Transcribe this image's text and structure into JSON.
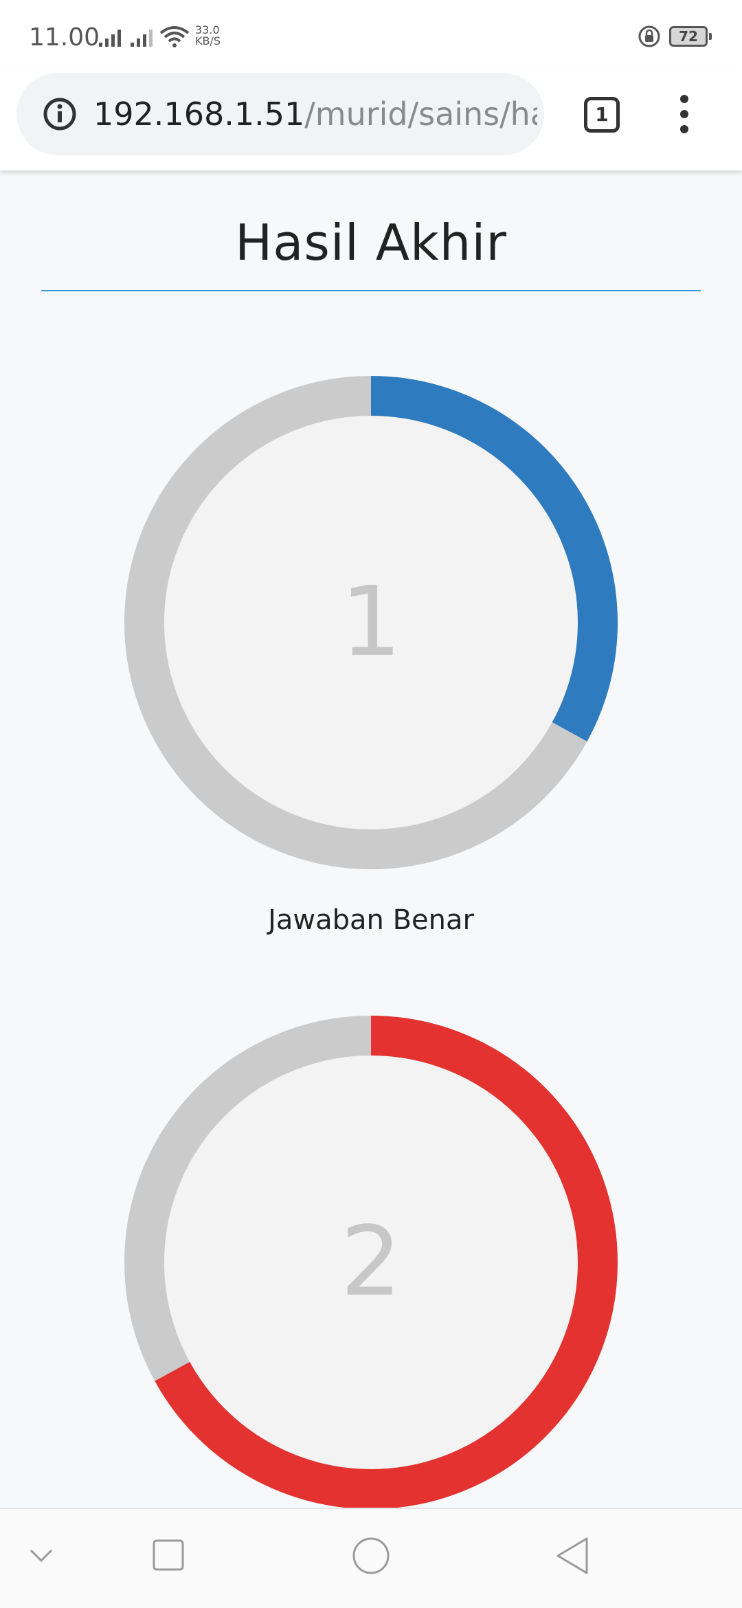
{
  "status_bar": {
    "time": "11.00",
    "net_speed_value": "33.0",
    "net_speed_unit": "KB/S",
    "battery": "72"
  },
  "browser": {
    "url_host": "192.168.1.51",
    "url_path": "/murid/sains/ha",
    "tab_count": "1"
  },
  "page": {
    "title": "Hasil Akhir",
    "results": [
      {
        "value": "1",
        "label": "Jawaban Benar",
        "fraction": 0.33,
        "color": "#2f7bbf"
      },
      {
        "value": "2",
        "label": "",
        "fraction": 0.67,
        "color": "#e33230"
      }
    ],
    "track_color": "#cbcbcb",
    "inner_color": "#f3f3f3",
    "title_rule_color": "#3a9ad9"
  },
  "icons": {
    "info": "info-icon",
    "menu": "more-vert-icon",
    "nav_down": "chevron-down-icon",
    "nav_recents": "square-icon",
    "nav_home": "circle-icon",
    "nav_back": "triangle-back-icon"
  }
}
